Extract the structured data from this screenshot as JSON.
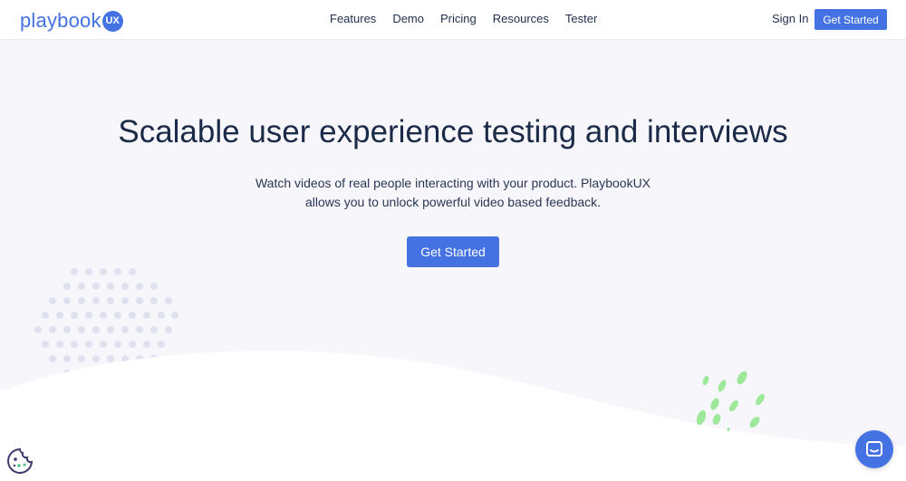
{
  "brand": {
    "logo_text": "playbook",
    "logo_badge": "UX",
    "accent": "#4472e3"
  },
  "nav": {
    "items": [
      {
        "label": "Features"
      },
      {
        "label": "Demo"
      },
      {
        "label": "Pricing"
      },
      {
        "label": "Resources"
      },
      {
        "label": "Tester"
      }
    ],
    "sign_in": "Sign In",
    "cta": "Get Started"
  },
  "hero": {
    "title": "Scalable user experience testing and interviews",
    "subtitle": "Watch videos of real people interacting with your product. PlaybookUX allows you to unlock powerful video based feedback.",
    "cta": "Get Started"
  },
  "widgets": {
    "cookie_icon": "cookie-icon",
    "chat_icon": "chat-icon"
  }
}
